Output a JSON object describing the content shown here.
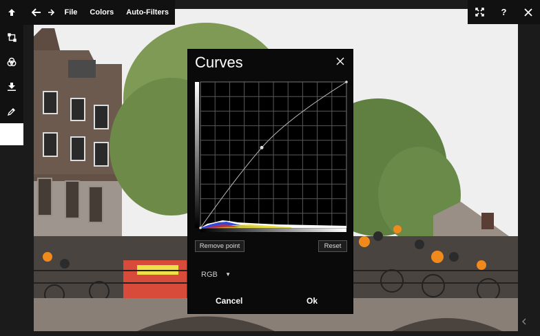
{
  "toolbar": {
    "back_icon": "undo-icon",
    "forward_icon": "redo-icon",
    "file_label": "File",
    "colors_label": "Colors",
    "autofilters_label": "Auto-Filters"
  },
  "window_controls": {
    "fullscreen_icon": "fullscreen-icon",
    "help_label": "?",
    "close_icon": "close-icon"
  },
  "sidebar": {
    "items": [
      {
        "icon": "upload-icon"
      },
      {
        "icon": "crop-icon"
      },
      {
        "icon": "color-circles-icon"
      },
      {
        "icon": "download-icon"
      },
      {
        "icon": "eyedropper-icon"
      }
    ],
    "swatch_color": "#ffffff"
  },
  "curves_dialog": {
    "title": "Curves",
    "remove_point_label": "Remove point",
    "reset_label": "Reset",
    "channel": "RGB",
    "cancel_label": "Cancel",
    "ok_label": "Ok",
    "control_points": [
      [
        0,
        0
      ],
      [
        0.42,
        0.55
      ],
      [
        1,
        1
      ]
    ]
  },
  "colors": {
    "dialog_bg": "#0a0a0a",
    "toolbar_bg": "#111111",
    "curve": "#bbbbbb"
  }
}
